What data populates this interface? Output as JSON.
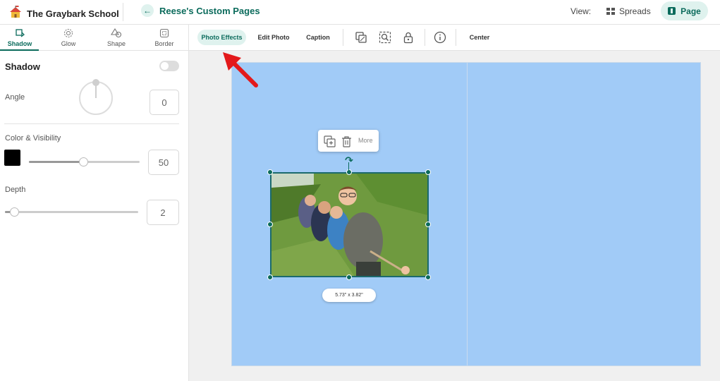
{
  "header": {
    "school_name": "The Graybark School",
    "back_title": "Reese's Custom Pages",
    "view_label": "View:",
    "spreads_label": "Spreads",
    "page_label": "Page"
  },
  "left_tabs": [
    {
      "label": "Shadow",
      "icon": "shadow-icon",
      "active": true
    },
    {
      "label": "Glow",
      "icon": "glow-icon",
      "active": false
    },
    {
      "label": "Shape",
      "icon": "shape-icon",
      "active": false
    },
    {
      "label": "Border",
      "icon": "border-icon",
      "active": false
    }
  ],
  "shadow_panel": {
    "title": "Shadow",
    "toggle_on": false,
    "angle_label": "Angle",
    "angle_value": "0",
    "color_label": "Color & Visibility",
    "color_value": "#000000",
    "visibility_value": "50",
    "depth_label": "Depth",
    "depth_value": "2"
  },
  "toolbar": {
    "photo_effects": "Photo Effects",
    "edit_photo": "Edit Photo",
    "caption": "Caption",
    "center": "Center",
    "icons": [
      "layers-icon",
      "zoom-frame-icon",
      "lock-icon",
      "info-icon"
    ]
  },
  "canvas": {
    "page_color": "#a1cbf7",
    "popup_more": "More",
    "photo_size": "5.73\" x 3.82\""
  },
  "colors": {
    "accent": "#0b6b5c",
    "accent_light": "#dff2ee",
    "annotation_arrow": "#e3191b"
  }
}
